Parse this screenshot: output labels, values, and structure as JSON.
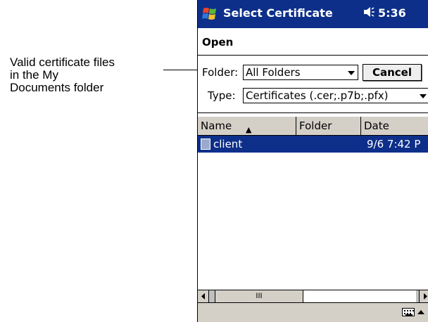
{
  "callout": {
    "line1": "Valid certificate files",
    "line2": "in the My",
    "line3": "Documents folder"
  },
  "titlebar": {
    "title": "Select Certificate",
    "time": "5:36"
  },
  "menubar": {
    "open_label": "Open"
  },
  "folder": {
    "label": "Folder:",
    "value": "All Folders"
  },
  "cancel_label": "Cancel",
  "type": {
    "label": "Type:",
    "value": "Certificates (.cer;.p7b;.pfx)"
  },
  "list": {
    "columns": [
      "Name",
      "Folder",
      "Date"
    ],
    "rows": [
      {
        "name": "client",
        "folder": "",
        "date": "9/6 7:42 P"
      }
    ]
  },
  "scroll": {
    "thumb_label": "III"
  },
  "colors": {
    "titlebar": "#0d2f8a",
    "selection": "#0d2f8a",
    "chrome": "#d4d0c8"
  }
}
